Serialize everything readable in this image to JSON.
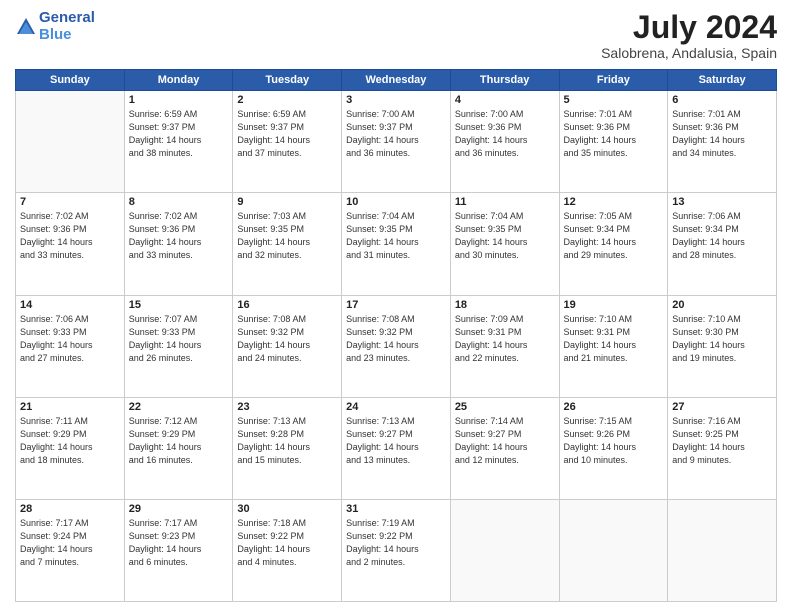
{
  "logo": {
    "line1": "General",
    "line2": "Blue"
  },
  "title": "July 2024",
  "location": "Salobrena, Andalusia, Spain",
  "days_header": [
    "Sunday",
    "Monday",
    "Tuesday",
    "Wednesday",
    "Thursday",
    "Friday",
    "Saturday"
  ],
  "weeks": [
    [
      {
        "day": "",
        "info": ""
      },
      {
        "day": "1",
        "info": "Sunrise: 6:59 AM\nSunset: 9:37 PM\nDaylight: 14 hours\nand 38 minutes."
      },
      {
        "day": "2",
        "info": "Sunrise: 6:59 AM\nSunset: 9:37 PM\nDaylight: 14 hours\nand 37 minutes."
      },
      {
        "day": "3",
        "info": "Sunrise: 7:00 AM\nSunset: 9:37 PM\nDaylight: 14 hours\nand 36 minutes."
      },
      {
        "day": "4",
        "info": "Sunrise: 7:00 AM\nSunset: 9:36 PM\nDaylight: 14 hours\nand 36 minutes."
      },
      {
        "day": "5",
        "info": "Sunrise: 7:01 AM\nSunset: 9:36 PM\nDaylight: 14 hours\nand 35 minutes."
      },
      {
        "day": "6",
        "info": "Sunrise: 7:01 AM\nSunset: 9:36 PM\nDaylight: 14 hours\nand 34 minutes."
      }
    ],
    [
      {
        "day": "7",
        "info": "Sunrise: 7:02 AM\nSunset: 9:36 PM\nDaylight: 14 hours\nand 33 minutes."
      },
      {
        "day": "8",
        "info": "Sunrise: 7:02 AM\nSunset: 9:36 PM\nDaylight: 14 hours\nand 33 minutes."
      },
      {
        "day": "9",
        "info": "Sunrise: 7:03 AM\nSunset: 9:35 PM\nDaylight: 14 hours\nand 32 minutes."
      },
      {
        "day": "10",
        "info": "Sunrise: 7:04 AM\nSunset: 9:35 PM\nDaylight: 14 hours\nand 31 minutes."
      },
      {
        "day": "11",
        "info": "Sunrise: 7:04 AM\nSunset: 9:35 PM\nDaylight: 14 hours\nand 30 minutes."
      },
      {
        "day": "12",
        "info": "Sunrise: 7:05 AM\nSunset: 9:34 PM\nDaylight: 14 hours\nand 29 minutes."
      },
      {
        "day": "13",
        "info": "Sunrise: 7:06 AM\nSunset: 9:34 PM\nDaylight: 14 hours\nand 28 minutes."
      }
    ],
    [
      {
        "day": "14",
        "info": "Sunrise: 7:06 AM\nSunset: 9:33 PM\nDaylight: 14 hours\nand 27 minutes."
      },
      {
        "day": "15",
        "info": "Sunrise: 7:07 AM\nSunset: 9:33 PM\nDaylight: 14 hours\nand 26 minutes."
      },
      {
        "day": "16",
        "info": "Sunrise: 7:08 AM\nSunset: 9:32 PM\nDaylight: 14 hours\nand 24 minutes."
      },
      {
        "day": "17",
        "info": "Sunrise: 7:08 AM\nSunset: 9:32 PM\nDaylight: 14 hours\nand 23 minutes."
      },
      {
        "day": "18",
        "info": "Sunrise: 7:09 AM\nSunset: 9:31 PM\nDaylight: 14 hours\nand 22 minutes."
      },
      {
        "day": "19",
        "info": "Sunrise: 7:10 AM\nSunset: 9:31 PM\nDaylight: 14 hours\nand 21 minutes."
      },
      {
        "day": "20",
        "info": "Sunrise: 7:10 AM\nSunset: 9:30 PM\nDaylight: 14 hours\nand 19 minutes."
      }
    ],
    [
      {
        "day": "21",
        "info": "Sunrise: 7:11 AM\nSunset: 9:29 PM\nDaylight: 14 hours\nand 18 minutes."
      },
      {
        "day": "22",
        "info": "Sunrise: 7:12 AM\nSunset: 9:29 PM\nDaylight: 14 hours\nand 16 minutes."
      },
      {
        "day": "23",
        "info": "Sunrise: 7:13 AM\nSunset: 9:28 PM\nDaylight: 14 hours\nand 15 minutes."
      },
      {
        "day": "24",
        "info": "Sunrise: 7:13 AM\nSunset: 9:27 PM\nDaylight: 14 hours\nand 13 minutes."
      },
      {
        "day": "25",
        "info": "Sunrise: 7:14 AM\nSunset: 9:27 PM\nDaylight: 14 hours\nand 12 minutes."
      },
      {
        "day": "26",
        "info": "Sunrise: 7:15 AM\nSunset: 9:26 PM\nDaylight: 14 hours\nand 10 minutes."
      },
      {
        "day": "27",
        "info": "Sunrise: 7:16 AM\nSunset: 9:25 PM\nDaylight: 14 hours\nand 9 minutes."
      }
    ],
    [
      {
        "day": "28",
        "info": "Sunrise: 7:17 AM\nSunset: 9:24 PM\nDaylight: 14 hours\nand 7 minutes."
      },
      {
        "day": "29",
        "info": "Sunrise: 7:17 AM\nSunset: 9:23 PM\nDaylight: 14 hours\nand 6 minutes."
      },
      {
        "day": "30",
        "info": "Sunrise: 7:18 AM\nSunset: 9:22 PM\nDaylight: 14 hours\nand 4 minutes."
      },
      {
        "day": "31",
        "info": "Sunrise: 7:19 AM\nSunset: 9:22 PM\nDaylight: 14 hours\nand 2 minutes."
      },
      {
        "day": "",
        "info": ""
      },
      {
        "day": "",
        "info": ""
      },
      {
        "day": "",
        "info": ""
      }
    ]
  ]
}
